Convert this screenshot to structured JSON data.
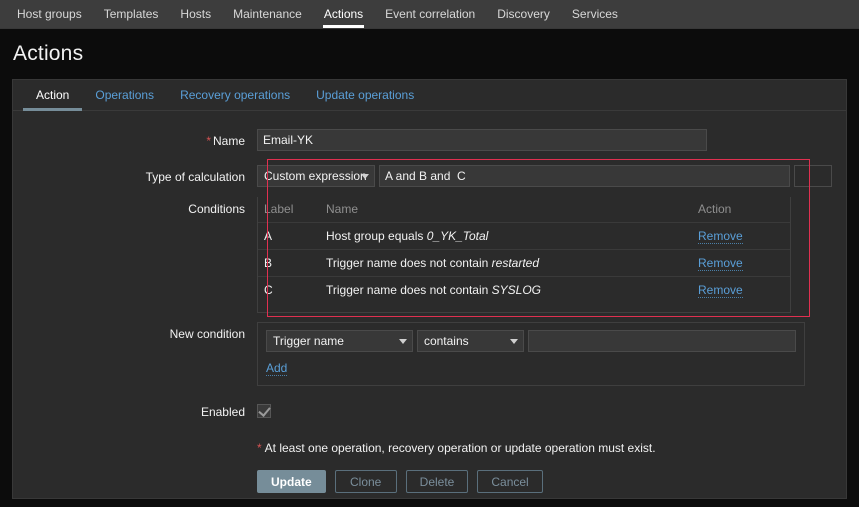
{
  "topnav": {
    "items": [
      {
        "label": "Host groups",
        "active": false
      },
      {
        "label": "Templates",
        "active": false
      },
      {
        "label": "Hosts",
        "active": false
      },
      {
        "label": "Maintenance",
        "active": false
      },
      {
        "label": "Actions",
        "active": true
      },
      {
        "label": "Event correlation",
        "active": false
      },
      {
        "label": "Discovery",
        "active": false
      },
      {
        "label": "Services",
        "active": false
      }
    ]
  },
  "header": {
    "title": "Actions"
  },
  "tabs": [
    {
      "label": "Action",
      "active": true
    },
    {
      "label": "Operations",
      "active": false
    },
    {
      "label": "Recovery operations",
      "active": false
    },
    {
      "label": "Update operations",
      "active": false
    }
  ],
  "form": {
    "name": {
      "label": "Name",
      "required": "*",
      "value": "Email-YK",
      "placeholder": ""
    },
    "type_of_calculation": {
      "label": "Type of calculation",
      "selected": "Custom expression",
      "expression": "A and B and  C",
      "expression_placeholder": ""
    },
    "conditions": {
      "label": "Conditions",
      "columns": [
        "Label",
        "Name",
        "Action"
      ],
      "rows": [
        {
          "label": "A",
          "name_prefix": "Host group equals ",
          "name_value": "0_YK_Total",
          "action": "Remove"
        },
        {
          "label": "B",
          "name_prefix": "Trigger name does not contain ",
          "name_value": "restarted",
          "action": "Remove"
        },
        {
          "label": "C",
          "name_prefix": "Trigger name does not contain ",
          "name_value": "SYSLOG",
          "action": "Remove"
        }
      ]
    },
    "new_condition": {
      "label": "New condition",
      "type_selected": "Trigger name",
      "operator_selected": "contains",
      "value": "",
      "value_placeholder": "",
      "add_label": "Add"
    },
    "enabled": {
      "label": "Enabled",
      "checked": true
    },
    "note": {
      "marker": "*",
      "text": "At least one operation, recovery operation or update operation must exist."
    },
    "buttons": [
      {
        "label": "Update",
        "primary": true
      },
      {
        "label": "Clone",
        "primary": false
      },
      {
        "label": "Delete",
        "primary": false
      },
      {
        "label": "Cancel",
        "primary": false
      }
    ]
  },
  "colors": {
    "accent_link": "#5a9fd8",
    "highlight_box": "#e03050",
    "required": "#d45353",
    "primary_button": "#768d99"
  }
}
